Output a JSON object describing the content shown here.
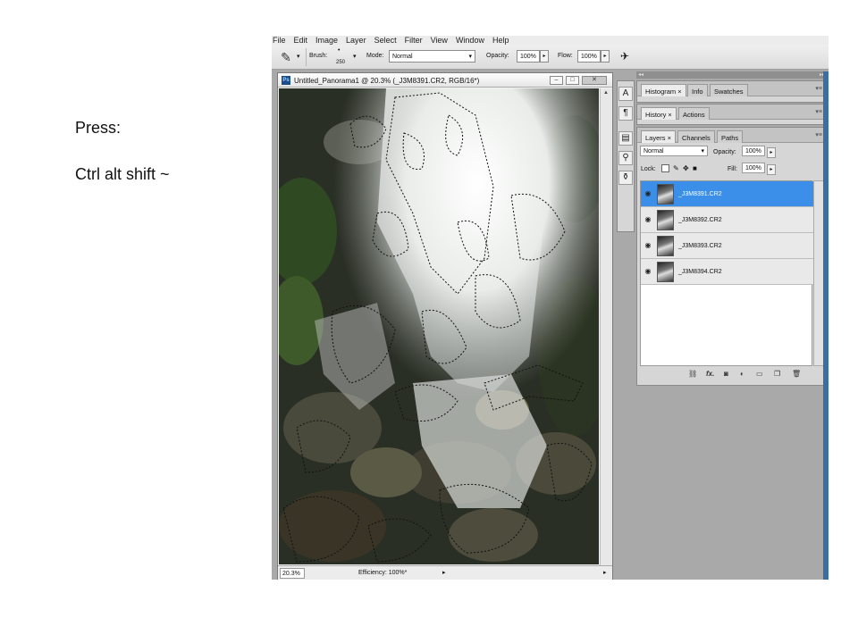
{
  "slide": {
    "line1": "Press:",
    "line2": "Ctrl alt shift ~"
  },
  "menu": [
    "File",
    "Edit",
    "Image",
    "Layer",
    "Select",
    "Filter",
    "View",
    "Window",
    "Help"
  ],
  "options": {
    "brush_label": "Brush:",
    "brush_size": "250",
    "mode_label": "Mode:",
    "mode_value": "Normal",
    "opacity_label": "Opacity:",
    "opacity_value": "100%",
    "flow_label": "Flow:",
    "flow_value": "100%"
  },
  "document": {
    "title": "Untitled_Panorama1 @ 20.3% (_J3M8391.CR2, RGB/16*)",
    "zoom": "20.3%",
    "status": "Efficiency: 100%*"
  },
  "panels": {
    "group1_tabs": [
      "Histogram",
      "Info",
      "Swatches"
    ],
    "group2_tabs": [
      "History",
      "Actions"
    ],
    "group3_tabs": [
      "Layers",
      "Channels",
      "Paths"
    ],
    "blend_mode": "Normal",
    "opacity_label": "Opacity:",
    "opacity_value": "100%",
    "lock_label": "Lock:",
    "fill_label": "Fill:",
    "fill_value": "100%",
    "layers": [
      "_J3M8391.CR2",
      "_J3M8392.CR2",
      "_J3M8393.CR2",
      "_J3M8394.CR2"
    ],
    "footer_icons": [
      "link-icon",
      "fx-icon",
      "mask-icon",
      "adjustment-icon",
      "group-icon",
      "new-layer-icon",
      "trash-icon"
    ]
  },
  "colors": {
    "selected_layer": "#3b8fe8",
    "panel_bg": "#d6d6d6",
    "workspace": "#a9a9a9"
  }
}
